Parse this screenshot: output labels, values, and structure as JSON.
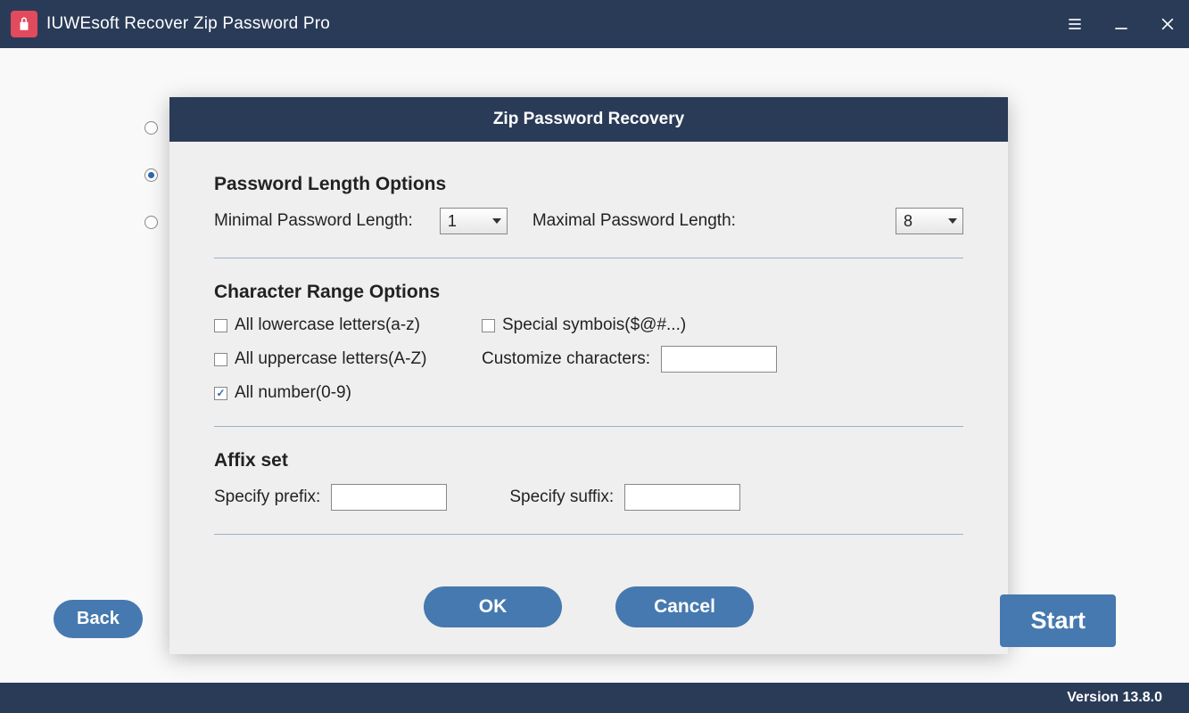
{
  "titlebar": {
    "title": "IUWEsoft Recover Zip Password Pro"
  },
  "dialog": {
    "title": "Zip Password Recovery",
    "password_length_heading": "Password Length Options",
    "min_label": "Minimal Password Length:",
    "min_value": "1",
    "max_label": "Maximal Password Length:",
    "max_value": "8",
    "char_range_heading": "Character Range Options",
    "checkboxes": {
      "lowercase": "All lowercase letters(a-z)",
      "uppercase": "All uppercase letters(A-Z)",
      "numbers": "All number(0-9)",
      "special": "Special symbois($@#...)"
    },
    "customize_label": "Customize characters:",
    "customize_value": "",
    "affix_heading": "Affix set",
    "prefix_label": "Specify prefix:",
    "prefix_value": "",
    "suffix_label": "Specify suffix:",
    "suffix_value": "",
    "ok_label": "OK",
    "cancel_label": "Cancel"
  },
  "buttons": {
    "back": "Back",
    "start": "Start"
  },
  "statusbar": {
    "version": "Version 13.8.0"
  }
}
